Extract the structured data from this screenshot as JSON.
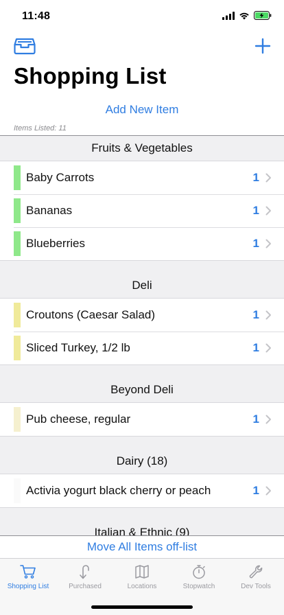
{
  "status_bar": {
    "time": "11:48",
    "icons": [
      "cellular-signal-icon",
      "wifi-icon",
      "battery-charging-icon"
    ],
    "battery_color": "#4cd964"
  },
  "nav": {
    "left_icon": "inbox-tray-icon",
    "right_icon": "plus-icon",
    "title": "Shopping List"
  },
  "add_new_label": "Add New Item",
  "items_listed": "Items Listed: 11",
  "sections": [
    {
      "header": "Fruits & Vegetables",
      "color": "#8fe88a",
      "items": [
        {
          "label": "Baby Carrots",
          "qty": "1"
        },
        {
          "label": "Bananas",
          "qty": "1"
        },
        {
          "label": "Blueberries",
          "qty": "1"
        }
      ]
    },
    {
      "header": "Deli",
      "color": "#f0ea9a",
      "items": [
        {
          "label": "Croutons (Caesar Salad)",
          "qty": "1"
        },
        {
          "label": "Sliced Turkey, 1/2 lb",
          "qty": "1"
        }
      ]
    },
    {
      "header": "Beyond Deli",
      "color": "#f5f0cf",
      "items": [
        {
          "label": "Pub cheese, regular",
          "qty": "1"
        }
      ]
    },
    {
      "header": "Dairy (18)",
      "color": "#fafafa",
      "items": [
        {
          "label": "Activia yogurt black cherry or peach",
          "qty": "1"
        }
      ]
    },
    {
      "header": "Italian & Ethnic (9)",
      "color": "#ffffff",
      "items": []
    }
  ],
  "move_all_label": "Move All Items off-list",
  "tabs": [
    {
      "label": "Shopping List",
      "icon": "cart-icon",
      "active": true
    },
    {
      "label": "Purchased",
      "icon": "purchased-icon",
      "active": false
    },
    {
      "label": "Locations",
      "icon": "map-icon",
      "active": false
    },
    {
      "label": "Stopwatch",
      "icon": "stopwatch-icon",
      "active": false
    },
    {
      "label": "Dev Tools",
      "icon": "wrench-icon",
      "active": false
    }
  ],
  "accent_color": "#2f7de1"
}
